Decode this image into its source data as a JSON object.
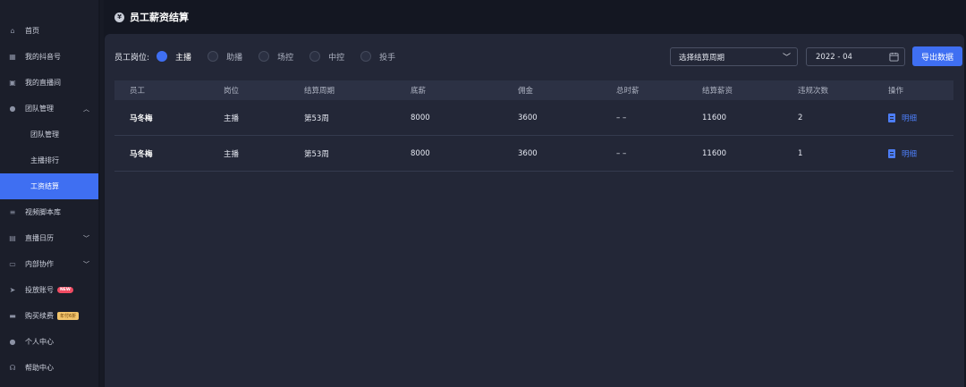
{
  "sidebar": {
    "items": [
      {
        "label": "首页",
        "icon": "home-icon"
      },
      {
        "label": "我的抖音号",
        "icon": "grid-icon"
      },
      {
        "label": "我的直播间",
        "icon": "live-icon"
      },
      {
        "label": "团队管理",
        "icon": "team-icon",
        "expanded": true
      },
      {
        "label": "团队管理",
        "sub": true
      },
      {
        "label": "主播排行",
        "sub": true
      },
      {
        "label": "工资结算",
        "sub": true,
        "active": true
      },
      {
        "label": "视频脚本库",
        "icon": "video-icon"
      },
      {
        "label": "直播日历",
        "icon": "calendar-icon",
        "collapsible": true
      },
      {
        "label": "内部协作",
        "icon": "collab-icon",
        "collapsible": true
      },
      {
        "label": "投放账号",
        "icon": "send-icon",
        "badge": "NEW"
      },
      {
        "label": "购买续费",
        "icon": "card-icon",
        "promo": "年付6折"
      },
      {
        "label": "个人中心",
        "icon": "user-icon"
      },
      {
        "label": "帮助中心",
        "icon": "help-icon"
      }
    ]
  },
  "header": {
    "title": "员工薪资结算",
    "icon": "yen-icon"
  },
  "filters": {
    "role_label": "员工岗位:",
    "roles": [
      "主播",
      "助播",
      "场控",
      "中控",
      "投手"
    ],
    "selected_role": "主播",
    "period_placeholder": "选择结算周期",
    "month": "2022 - 04",
    "export_label": "导出数据"
  },
  "table": {
    "headers": [
      "员工",
      "岗位",
      "结算周期",
      "底薪",
      "佣金",
      "总时薪",
      "结算薪资",
      "违规次数",
      "操作"
    ],
    "rows": [
      [
        "马冬梅",
        "主播",
        "第53周",
        "8000",
        "3600",
        "– –",
        "11600",
        "2",
        "明细"
      ],
      [
        "马冬梅",
        "主播",
        "第53周",
        "8000",
        "3600",
        "– –",
        "11600",
        "1",
        "明细"
      ]
    ]
  },
  "colors": {
    "accent": "#3f6ff2",
    "panel": "#232737",
    "background": "#141722"
  }
}
